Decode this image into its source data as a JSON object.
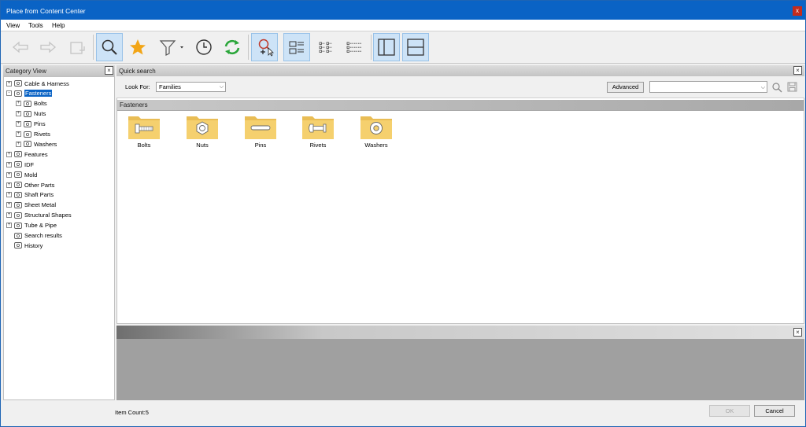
{
  "window": {
    "title": "Place from Content Center",
    "close_glyph": "x"
  },
  "menu": [
    "View",
    "Tools",
    "Help"
  ],
  "toolbar": {
    "icons": [
      "back-arrow-icon",
      "forward-arrow-icon",
      "up-folder-icon",
      "search-icon",
      "favorites-star-icon",
      "filter-icon",
      "history-clock-icon",
      "refresh-icon",
      "add-search-icon",
      "list-view-icon",
      "small-icons-view-icon",
      "details-view-icon",
      "tree-pane-icon",
      "preview-pane-icon"
    ]
  },
  "category_view": {
    "title": "Category View",
    "items": [
      {
        "label": "Cable & Harness",
        "icon": "cable-icon",
        "expander": "+"
      },
      {
        "label": "Fasteners",
        "icon": "fastener-icon",
        "expander": "-",
        "selected": true
      },
      {
        "label": "Bolts",
        "icon": "bolt-icon",
        "expander": "+"
      },
      {
        "label": "Nuts",
        "icon": "nut-icon",
        "expander": "+"
      },
      {
        "label": "Pins",
        "icon": "pin-icon",
        "expander": "+"
      },
      {
        "label": "Rivets",
        "icon": "rivet-icon",
        "expander": "+"
      },
      {
        "label": "Washers",
        "icon": "washer-icon",
        "expander": "+"
      },
      {
        "label": "Features",
        "icon": "feature-icon",
        "expander": "+"
      },
      {
        "label": "IDF",
        "icon": "idf-icon",
        "expander": "+"
      },
      {
        "label": "Mold",
        "icon": "mold-icon",
        "expander": "+"
      },
      {
        "label": "Other Parts",
        "icon": "other-parts-icon",
        "expander": "+"
      },
      {
        "label": "Shaft Parts",
        "icon": "shaft-icon",
        "expander": "+"
      },
      {
        "label": "Sheet Metal",
        "icon": "sheet-metal-icon",
        "expander": "+"
      },
      {
        "label": "Structural Shapes",
        "icon": "structural-icon",
        "expander": "+"
      },
      {
        "label": "Tube & Pipe",
        "icon": "tube-icon",
        "expander": "+"
      },
      {
        "label": "Search results",
        "icon": "search-icon",
        "expander": ""
      },
      {
        "label": "History",
        "icon": "history-clock-icon",
        "expander": ""
      }
    ]
  },
  "quick_search": {
    "title": "Quick search",
    "look_for_label": "Look For:",
    "look_for_value": "Families",
    "advanced_label": "Advanced",
    "search_value": ""
  },
  "content": {
    "header": "Fasteners",
    "families": [
      {
        "label": "Bolts",
        "icon": "bolt-folder-icon"
      },
      {
        "label": "Nuts",
        "icon": "nut-folder-icon"
      },
      {
        "label": "Pins",
        "icon": "pin-folder-icon"
      },
      {
        "label": "Rivets",
        "icon": "rivet-folder-icon"
      },
      {
        "label": "Washers",
        "icon": "washer-folder-icon"
      }
    ]
  },
  "status": {
    "item_count": "Item Count:5"
  },
  "buttons": {
    "ok": "OK",
    "cancel": "Cancel"
  },
  "colors": {
    "title_bar": "#0a63c5",
    "selection": "#0a63c5",
    "folder": "#f5d06e",
    "refresh": "#2aa63a",
    "star": "#f2a516"
  }
}
